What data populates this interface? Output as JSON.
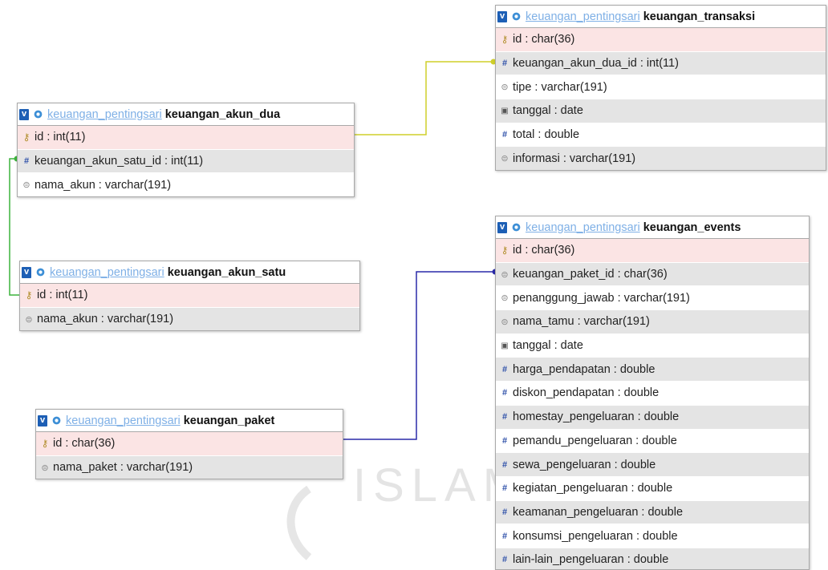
{
  "tables": {
    "akun_dua": {
      "database": "keuangan_pentingsari",
      "name": "keuangan_akun_dua",
      "columns": [
        {
          "icon": "key-icon",
          "label": "id : int(11)"
        },
        {
          "icon": "number-icon",
          "label": "keuangan_akun_satu_id : int(11)"
        },
        {
          "icon": "text-icon",
          "label": "nama_akun : varchar(191)"
        }
      ]
    },
    "akun_satu": {
      "database": "keuangan_pentingsari",
      "name": "keuangan_akun_satu",
      "columns": [
        {
          "icon": "key-icon",
          "label": "id : int(11)"
        },
        {
          "icon": "text-icon",
          "label": "nama_akun : varchar(191)"
        }
      ]
    },
    "paket": {
      "database": "keuangan_pentingsari",
      "name": "keuangan_paket",
      "columns": [
        {
          "icon": "key-icon",
          "label": "id : char(36)"
        },
        {
          "icon": "text-icon",
          "label": "nama_paket : varchar(191)"
        }
      ]
    },
    "transaksi": {
      "database": "keuangan_pentingsari",
      "name": "keuangan_transaksi",
      "columns": [
        {
          "icon": "key-icon",
          "label": "id : char(36)"
        },
        {
          "icon": "number-icon",
          "label": "keuangan_akun_dua_id : int(11)"
        },
        {
          "icon": "text-icon",
          "label": "tipe : varchar(191)"
        },
        {
          "icon": "date-icon",
          "label": "tanggal : date"
        },
        {
          "icon": "number-icon",
          "label": "total : double"
        },
        {
          "icon": "text-icon",
          "label": "informasi : varchar(191)"
        }
      ]
    },
    "events": {
      "database": "keuangan_pentingsari",
      "name": "keuangan_events",
      "columns": [
        {
          "icon": "key-icon",
          "label": "id : char(36)"
        },
        {
          "icon": "text-icon",
          "label": "keuangan_paket_id : char(36)"
        },
        {
          "icon": "text-icon",
          "label": "penanggung_jawab : varchar(191)"
        },
        {
          "icon": "text-icon",
          "label": "nama_tamu : varchar(191)"
        },
        {
          "icon": "date-icon",
          "label": "tanggal : date"
        },
        {
          "icon": "number-icon",
          "label": "harga_pendapatan : double"
        },
        {
          "icon": "number-icon",
          "label": "diskon_pendapatan : double"
        },
        {
          "icon": "number-icon",
          "label": "homestay_pengeluaran : double"
        },
        {
          "icon": "number-icon",
          "label": "pemandu_pengeluaran : double"
        },
        {
          "icon": "number-icon",
          "label": "sewa_pengeluaran : double"
        },
        {
          "icon": "number-icon",
          "label": "kegiatan_pengeluaran : double"
        },
        {
          "icon": "number-icon",
          "label": "keamanan_pengeluaran : double"
        },
        {
          "icon": "number-icon",
          "label": "konsumsi_pengeluaran : double"
        },
        {
          "icon": "number-icon",
          "label": "lain-lain_pengeluaran : double"
        }
      ]
    }
  },
  "toggle_glyph": "v",
  "watermark": "ISLAM",
  "link_colors": {
    "yellow": "#cfcf2a",
    "green": "#3cb33c",
    "blue": "#2a2aa8"
  },
  "accent": "#1d5fb5"
}
